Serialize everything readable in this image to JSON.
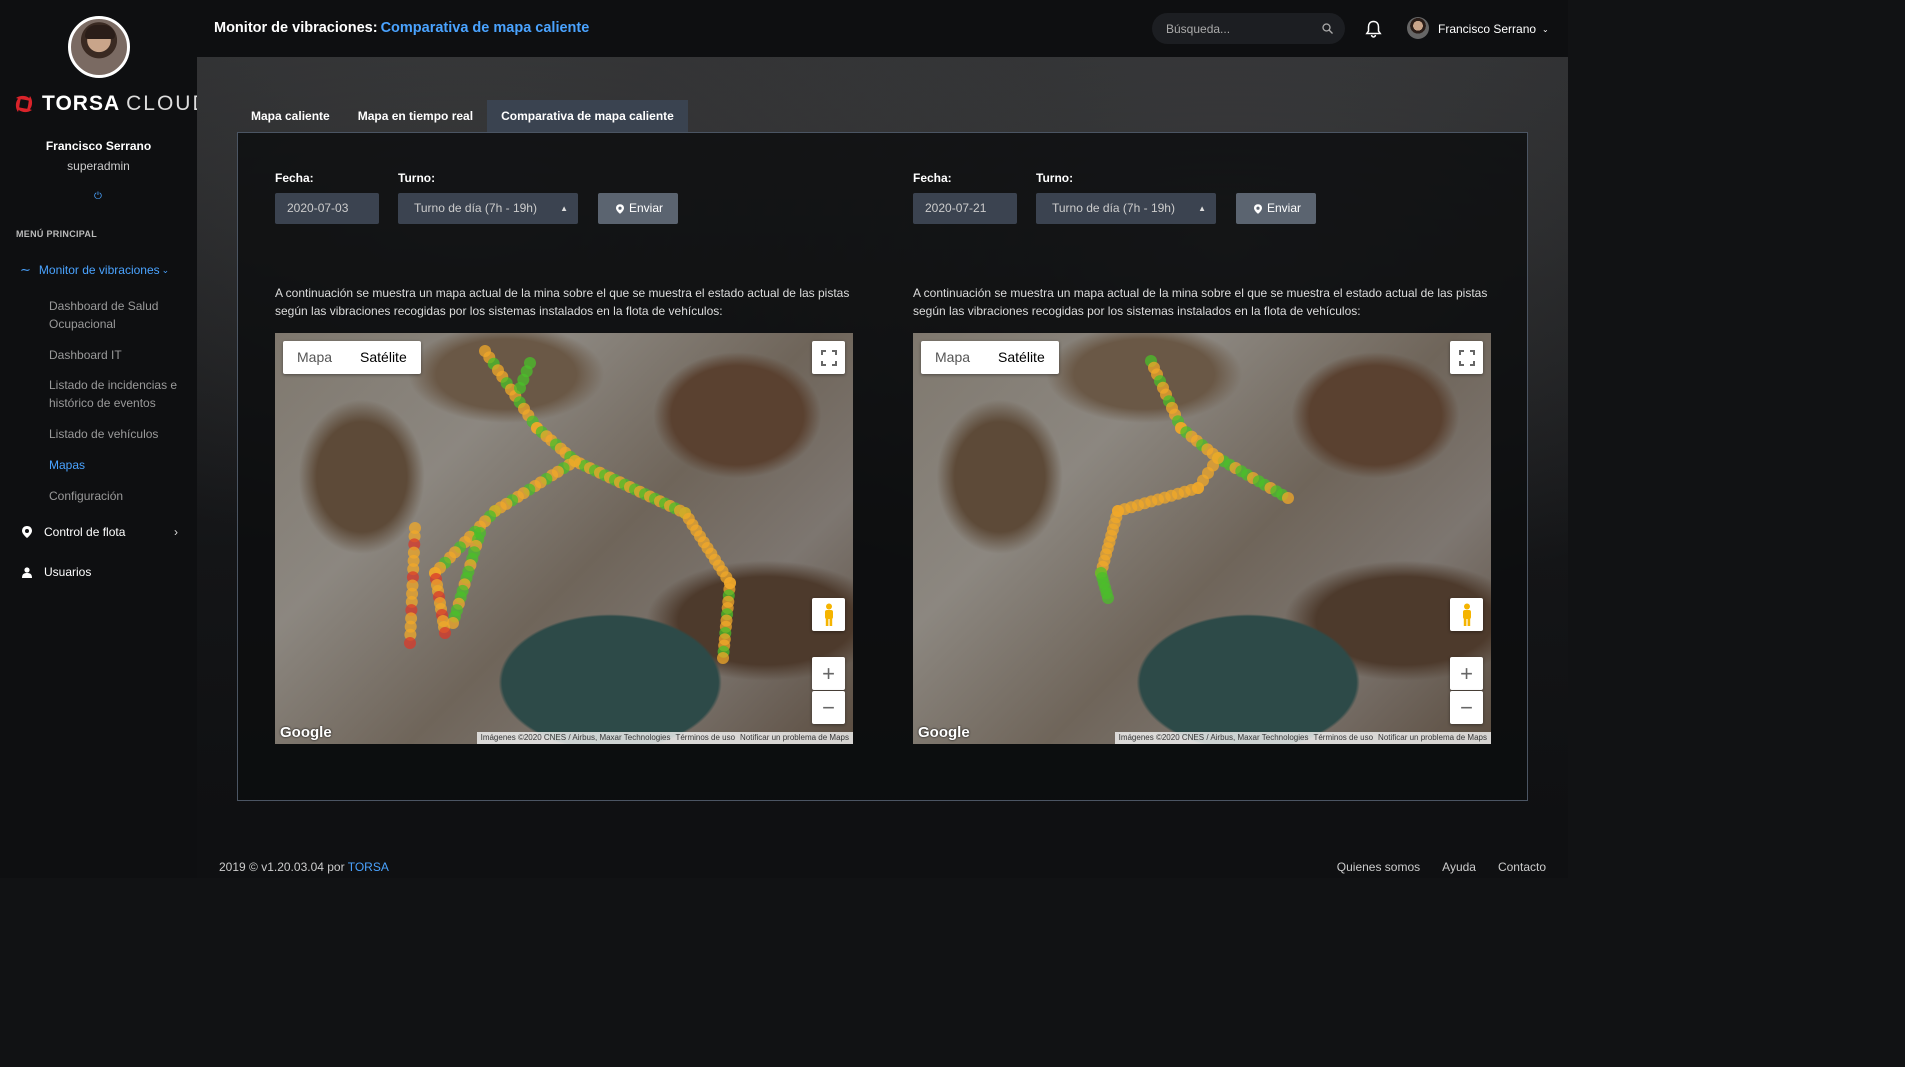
{
  "sidebar": {
    "user_name": "Francisco Serrano",
    "user_role": "superadmin",
    "logo_main": "TORSA",
    "logo_sub": "CLOUD",
    "menu_title": "MENÚ PRINCIPAL",
    "monitor_label": "Monitor de vibraciones",
    "submenu": [
      "Dashboard de Salud Ocupacional",
      "Dashboard IT",
      "Listado de incidencias e histórico de eventos",
      "Listado de vehículos",
      "Mapas",
      "Configuración"
    ],
    "active_submenu": "Mapas",
    "control_flota_label": "Control de flota",
    "usuarios_label": "Usuarios"
  },
  "header": {
    "title_prefix": "Monitor de vibraciones:",
    "title_accent": "Comparativa de mapa caliente",
    "search_placeholder": "Búsqueda...",
    "user_name": "Francisco Serrano"
  },
  "tabs": [
    {
      "label": "Mapa caliente",
      "active": false
    },
    {
      "label": "Mapa en tiempo real",
      "active": false
    },
    {
      "label": "Comparativa de mapa caliente",
      "active": true
    }
  ],
  "comparisons": [
    {
      "fecha_label": "Fecha:",
      "fecha_value": "2020-07-03",
      "turno_label": "Turno:",
      "turno_value": "Turno de día (7h - 19h)",
      "enviar_label": "Enviar",
      "description": "A continuación se muestra un mapa actual de la mina sobre el que se muestra el estado actual de las pistas según las vibraciones recogidas por los sistemas instalados en la flota de vehículos:",
      "map_btn_label": "Mapa",
      "satellite_btn_label": "Satélite",
      "google_label": "Google",
      "attribution": [
        "Imágenes ©2020 CNES / Airbus, Maxar Technologies",
        "Términos de uso",
        "Notificar un problema de Maps"
      ]
    },
    {
      "fecha_label": "Fecha:",
      "fecha_value": "2020-07-21",
      "turno_label": "Turno:",
      "turno_value": "Turno de día (7h - 19h)",
      "enviar_label": "Enviar",
      "description": "A continuación se muestra un mapa actual de la mina sobre el que se muestra el estado actual de las pistas según las vibraciones recogidas por los sistemas instalados en la flota de vehículos:",
      "map_btn_label": "Mapa",
      "satellite_btn_label": "Satélite",
      "google_label": "Google",
      "attribution": [
        "Imágenes ©2020 CNES / Airbus, Maxar Technologies",
        "Términos de uso",
        "Notificar un problema de Maps"
      ]
    }
  ],
  "footer": {
    "copyright": "2019 © v1.20.03.04 por",
    "brand": "TORSA",
    "links": [
      "Quienes somos",
      "Ayuda",
      "Contacto"
    ]
  },
  "colors": {
    "accent": "#4aa3ff",
    "level_green": "#4bbf2a",
    "level_orange": "#f0a82a",
    "level_red": "#d93a2b"
  }
}
